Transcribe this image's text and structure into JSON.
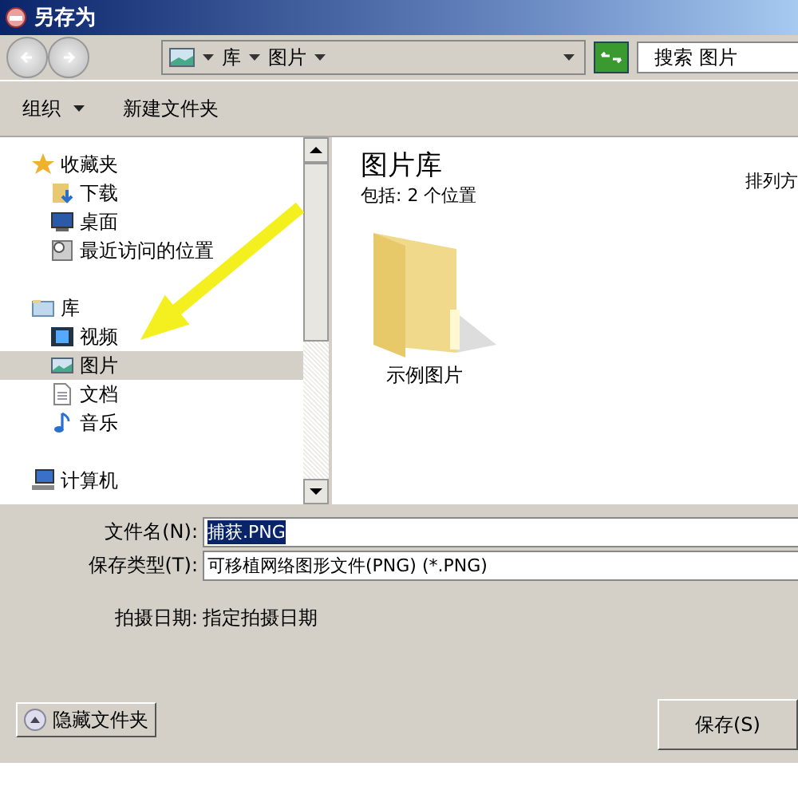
{
  "window": {
    "title": "另存为"
  },
  "address_bar": {
    "path": [
      {
        "label": "库"
      },
      {
        "label": "图片"
      }
    ],
    "search": {
      "placeholder": "搜索 图片"
    }
  },
  "toolbar": {
    "buttons": [
      {
        "label": "组织",
        "kind": "menu"
      },
      {
        "label": "新建文件夹",
        "kind": "plain"
      }
    ]
  },
  "sidebar": {
    "items": [
      {
        "label": "收藏夹",
        "kind": "star",
        "selected": false,
        "children": [
          {
            "label": "下载",
            "kind": "download",
            "selected": false
          },
          {
            "label": "桌面",
            "kind": "desktop",
            "selected": false
          },
          {
            "label": "最近访问的位置",
            "kind": "recent",
            "selected": false
          }
        ]
      },
      {
        "label": "库",
        "kind": "library",
        "selected": false,
        "children": [
          {
            "label": "视频",
            "kind": "video",
            "selected": false
          },
          {
            "label": "图片",
            "kind": "picture",
            "selected": true
          },
          {
            "label": "文档",
            "kind": "document",
            "selected": false
          },
          {
            "label": "音乐",
            "kind": "music",
            "selected": false
          }
        ]
      },
      {
        "label": "计算机",
        "kind": "computer",
        "selected": false
      }
    ]
  },
  "content": {
    "title": "图片库",
    "subtitle": "包括: 2 个位置",
    "arrange": "排列方",
    "items": [
      {
        "label": "示例图片"
      }
    ]
  },
  "form": {
    "fields": [
      {
        "label": "文件名(N):",
        "value": "捕获.PNG",
        "selected": true
      },
      {
        "label": "保存类型(T):",
        "value": "可移植网络图形文件(PNG) (*.PNG)",
        "selected": false
      }
    ],
    "date": {
      "label": "拍摄日期:",
      "value": "指定拍摄日期"
    }
  },
  "footer": {
    "hide_button": "隐藏文件夹",
    "save_button": "保存(S)"
  }
}
